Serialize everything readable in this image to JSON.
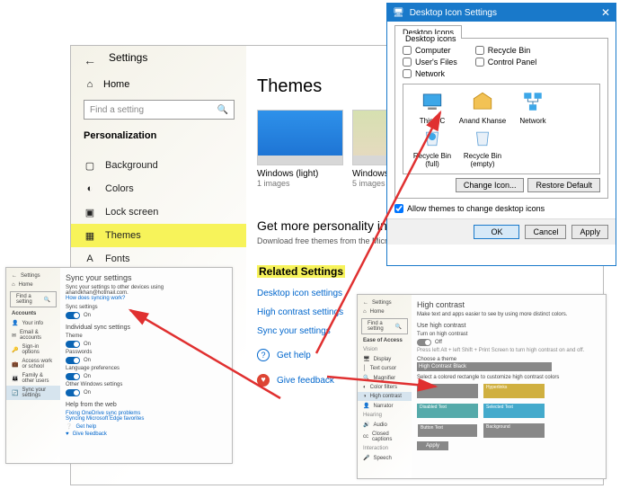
{
  "main": {
    "app_title": "Settings",
    "home": "Home",
    "search_placeholder": "Find a setting",
    "category": "Personalization",
    "nav": [
      "Background",
      "Colors",
      "Lock screen",
      "Themes",
      "Fonts"
    ],
    "themes_heading": "Themes",
    "thumbs": [
      {
        "title": "Windows (light)",
        "sub": "1 images"
      },
      {
        "title": "Windows",
        "sub": "5 images"
      }
    ],
    "personality_h": "Get more personality in Windows",
    "personality_d": "Download free themes from the Microsoft Store that combine wallpapers, sounds, and colors",
    "related_h": "Related Settings",
    "links": [
      "Desktop icon settings",
      "High contrast settings",
      "Sync your settings"
    ],
    "help": "Get help",
    "feedback": "Give feedback"
  },
  "dis": {
    "title": "Desktop Icon Settings",
    "tab": "Desktop Icons",
    "group": "Desktop icons",
    "checks_left": [
      "Computer",
      "User's Files",
      "Network"
    ],
    "checks_right": [
      "Recycle Bin",
      "Control Panel"
    ],
    "icons": [
      "This PC",
      "Anand Khanse",
      "Network",
      "Recycle Bin (full)",
      "Recycle Bin (empty)"
    ],
    "change": "Change Icon...",
    "restore": "Restore Default",
    "allow": "Allow themes to change desktop icons",
    "ok": "OK",
    "cancel": "Cancel",
    "apply": "Apply"
  },
  "sync": {
    "title": "Settings",
    "home": "Home",
    "search": "Find a setting",
    "cat": "Accounts",
    "nav": [
      "Your info",
      "Email & accounts",
      "Sign-in options",
      "Access work or school",
      "Family & other users",
      "Sync your settings"
    ],
    "h": "Sync your settings",
    "desc": "Sync your settings to other devices using anandkhan@hotmail.com.",
    "how": "How does syncing work?",
    "sync_label": "Sync settings",
    "ind_h": "Individual sync settings",
    "items": [
      "Theme",
      "Passwords",
      "Language preferences",
      "Other Windows settings"
    ],
    "on": "On",
    "webhelp_h": "Help from the web",
    "webhelp": [
      "Fixing OneDrive sync problems",
      "Syncing Microsoft Edge favorites"
    ],
    "gethelp": "Get help",
    "feedback": "Give feedback"
  },
  "hc": {
    "title": "Settings",
    "home": "Home",
    "search": "Find a setting",
    "cat": "Ease of Access",
    "groups": {
      "vision": "Vision",
      "hearing": "Hearing",
      "interaction": "Interaction"
    },
    "nav_vision": [
      "Display",
      "Text cursor",
      "Magnifier",
      "Color filters",
      "High contrast",
      "Narrator"
    ],
    "nav_hearing": [
      "Audio",
      "Closed captions"
    ],
    "nav_interaction": [
      "Speech"
    ],
    "h": "High contrast",
    "sub": "Make text and apps easier to see by using more distinct colors.",
    "use_h": "Use high contrast",
    "turn": "Turn on high contrast",
    "off": "Off",
    "hint": "Press left Alt + left Shift + Print Screen to turn high contrast on and off.",
    "choose": "Choose a theme",
    "theme_sel": "High Contrast Black",
    "rect_label": "Select a colored rectangle to customize high contrast colors",
    "swatches": [
      "Text",
      "Hyperlinks",
      "Disabled Text",
      "Selected Text",
      "Button Text",
      "Background"
    ],
    "apply": "Apply"
  }
}
